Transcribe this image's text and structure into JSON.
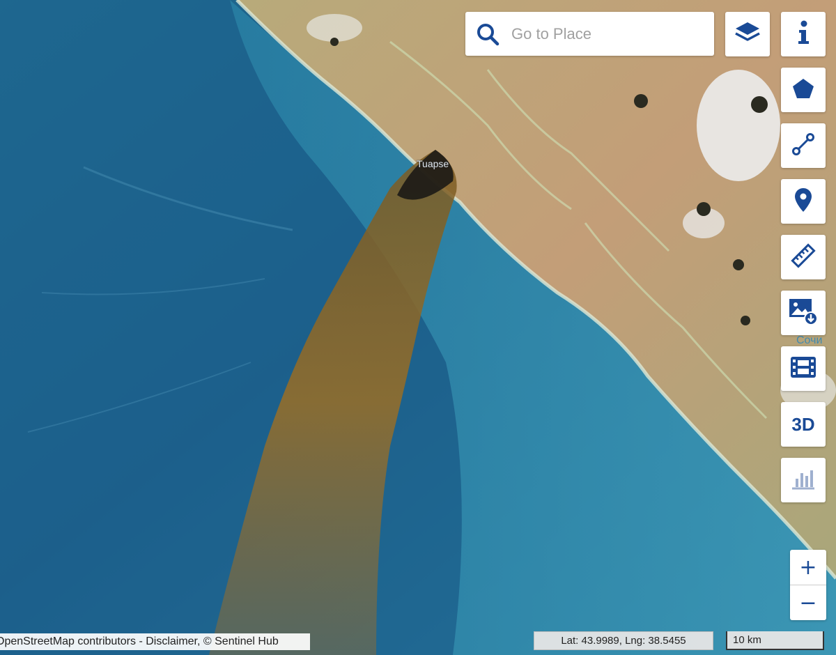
{
  "map": {
    "place_label": "Tuapse",
    "place_label_partial": "Сочи"
  },
  "search": {
    "placeholder": "Go to Place",
    "value": ""
  },
  "toolbar": {
    "layers_icon": "layers-icon",
    "info_icon": "info-icon",
    "polygon_icon": "pentagon-icon",
    "line_icon": "line-measure-icon",
    "pin_icon": "map-pin-icon",
    "ruler_icon": "ruler-icon",
    "image_download_icon": "image-download-icon",
    "timelapse_icon": "film-icon",
    "three_d_label": "3D",
    "chart_icon": "bar-chart-icon",
    "accent_color": "#1a4a96"
  },
  "zoom": {
    "in_label": "+",
    "out_label": "−"
  },
  "footer": {
    "attribution": "OpenStreetMap contributors - Disclaimer, © Sentinel Hub",
    "coordinates": "Lat: 43.9989, Lng: 38.5455",
    "scale": "10 km"
  }
}
